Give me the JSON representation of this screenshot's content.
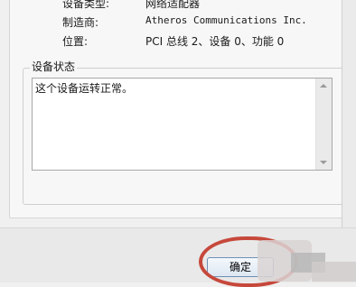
{
  "properties": {
    "device_type_label": "设备类型:",
    "device_type_value": "网络适配器",
    "manufacturer_label": "制造商:",
    "manufacturer_value": "Atheros Communications Inc.",
    "location_label": "位置:",
    "location_value": "PCI 总线 2、设备 0、功能 0"
  },
  "device_status": {
    "title": "设备状态",
    "text": "这个设备运转正常。"
  },
  "buttons": {
    "ok_label": "确定"
  },
  "colors": {
    "highlight_ring": "#c6483b",
    "ok_border": "#6f8fb5"
  }
}
